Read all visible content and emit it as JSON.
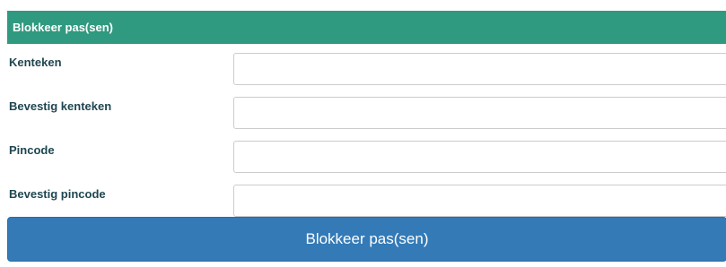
{
  "panel": {
    "title": "Blokkeer pas(sen)"
  },
  "form": {
    "fields": [
      {
        "label": "Kenteken",
        "value": ""
      },
      {
        "label": "Bevestig kenteken",
        "value": ""
      },
      {
        "label": "Pincode",
        "value": ""
      },
      {
        "label": "Bevestig pincode",
        "value": ""
      }
    ],
    "submit_label": "Blokkeer pas(sen)"
  },
  "colors": {
    "header_bg": "#2f9a7f",
    "label_text": "#1f4650",
    "button_bg": "#337ab7"
  }
}
